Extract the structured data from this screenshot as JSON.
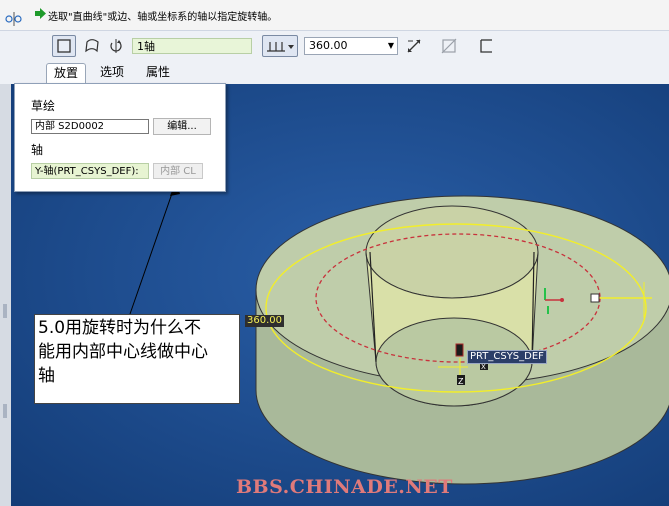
{
  "message": {
    "text": "选取\"直曲线\"或边、轴或坐标系的轴以指定旋转轴。"
  },
  "dashboard": {
    "axis_collector_value": "1轴",
    "angle_value": "360.00",
    "tabs": [
      {
        "label": "放置",
        "selected": true
      },
      {
        "label": "选项",
        "selected": false
      },
      {
        "label": "属性",
        "selected": false
      }
    ]
  },
  "placement_panel": {
    "sketch_heading": "草绘",
    "sketch_value": "内部 S2D0002",
    "edit_button": "编辑...",
    "axis_heading": "轴",
    "axis_value": "Y-轴(PRT_CSYS_DEF):",
    "internal_cl_button": "内部 CL"
  },
  "graphics": {
    "angle_label": "360.00",
    "csys_label": "PRT_CSYS_DEF",
    "csys_z_label": "Z",
    "csys_x_label": "X"
  },
  "annotation": {
    "text_line1": "5.0用旋转时为什么不",
    "text_line2": "能用内部中心线做中心",
    "text_line3": "轴"
  },
  "watermark": "BBS.CHINADE.NET",
  "colors": {
    "background": "#1e4a86",
    "solid_fill": "#b8c7a4",
    "sketch_yellow": "#f2ee2a",
    "dashed_red": "#c8323c",
    "collector_green": "#e7f4d2"
  }
}
